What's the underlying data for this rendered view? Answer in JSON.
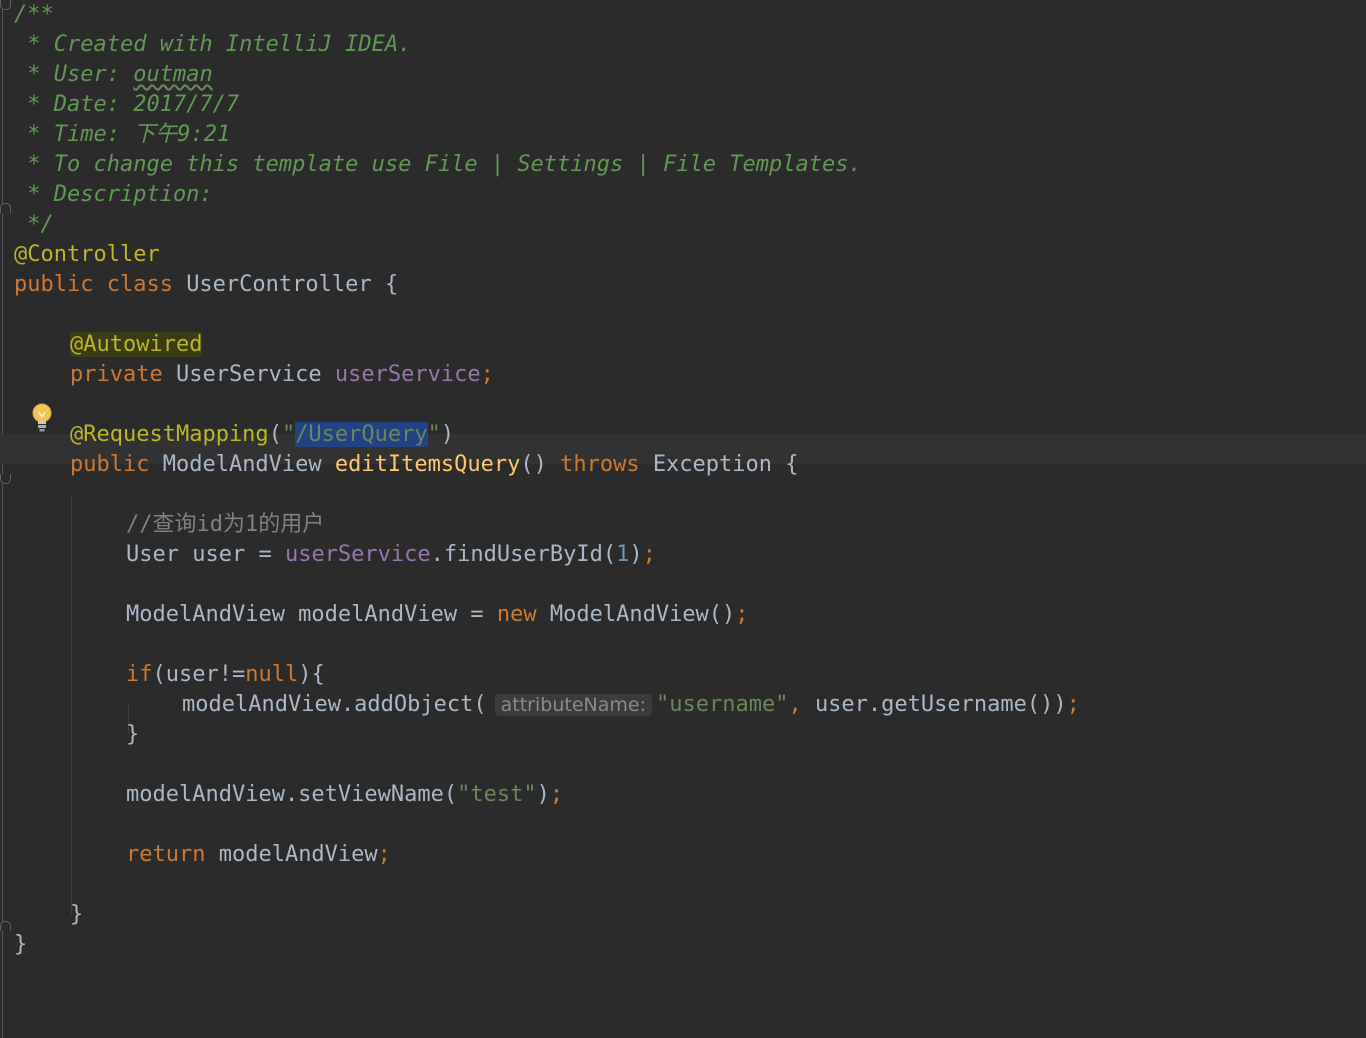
{
  "editor": {
    "code_lines": [
      {
        "row": 0,
        "tokens": [
          {
            "t": "/**",
            "c": "cmt-doc"
          }
        ]
      },
      {
        "row": 1,
        "tokens": [
          {
            "t": " * Created with IntelliJ IDEA.",
            "c": "cmt-doc"
          }
        ]
      },
      {
        "row": 2,
        "tokens": [
          {
            "t": " * User: ",
            "c": "cmt-doc"
          },
          {
            "t": "outman",
            "c": "cmt-doc typo"
          }
        ]
      },
      {
        "row": 3,
        "tokens": [
          {
            "t": " * Date: 2017/7/7",
            "c": "cmt-doc"
          }
        ]
      },
      {
        "row": 4,
        "tokens": [
          {
            "t": " * Time: 下午9:21",
            "c": "cmt-doc"
          }
        ]
      },
      {
        "row": 5,
        "tokens": [
          {
            "t": " * To change this template use File | Settings | File Templates.",
            "c": "cmt-doc"
          }
        ]
      },
      {
        "row": 6,
        "tokens": [
          {
            "t": " * Description:",
            "c": "cmt-doc"
          }
        ]
      },
      {
        "row": 7,
        "tokens": [
          {
            "t": " */",
            "c": "cmt-doc"
          }
        ]
      },
      {
        "row": 8,
        "indent": 0,
        "tokens": [
          {
            "t": "@Controller",
            "c": "ann"
          }
        ]
      },
      {
        "row": 9,
        "indent": 0,
        "tokens": [
          {
            "t": "public class ",
            "c": "kw"
          },
          {
            "t": "UserController {",
            "c": "plain"
          }
        ]
      },
      {
        "row": 11,
        "indent": 1,
        "tokens": [
          {
            "t": "@Autowired",
            "c": "ann autowired-hl"
          }
        ]
      },
      {
        "row": 12,
        "indent": 1,
        "tokens": [
          {
            "t": "private ",
            "c": "kw"
          },
          {
            "t": "UserService ",
            "c": "plain"
          },
          {
            "t": "userService",
            "c": "field"
          },
          {
            "t": ";",
            "c": "punct"
          }
        ]
      },
      {
        "row": 14,
        "indent": 1,
        "tokens": [
          {
            "t": "@RequestMapping",
            "c": "ann"
          },
          {
            "t": "(",
            "c": "plain"
          },
          {
            "t": "\"",
            "c": "str"
          },
          {
            "t": "/UserQuery",
            "c": "str selected"
          },
          {
            "t": "\"",
            "c": "str"
          },
          {
            "t": ")",
            "c": "plain"
          }
        ]
      },
      {
        "row": 15,
        "indent": 1,
        "tokens": [
          {
            "t": "public ",
            "c": "kw"
          },
          {
            "t": "ModelAndView ",
            "c": "plain"
          },
          {
            "t": "editItemsQuery",
            "c": "method"
          },
          {
            "t": "() ",
            "c": "plain"
          },
          {
            "t": "throws ",
            "c": "kw"
          },
          {
            "t": "Exception {",
            "c": "plain"
          }
        ]
      },
      {
        "row": 17,
        "indent": 2,
        "tokens": [
          {
            "t": "//查询id为1的用户",
            "c": "cmt"
          }
        ]
      },
      {
        "row": 18,
        "indent": 2,
        "tokens": [
          {
            "t": "User user = ",
            "c": "plain"
          },
          {
            "t": "userService",
            "c": "field"
          },
          {
            "t": ".findUserById(",
            "c": "plain"
          },
          {
            "t": "1",
            "c": "num"
          },
          {
            "t": ")",
            "c": "plain"
          },
          {
            "t": ";",
            "c": "punct"
          }
        ]
      },
      {
        "row": 20,
        "indent": 2,
        "tokens": [
          {
            "t": "ModelAndView modelAndView = ",
            "c": "plain"
          },
          {
            "t": "new ",
            "c": "kw"
          },
          {
            "t": "ModelAndView()",
            "c": "plain"
          },
          {
            "t": ";",
            "c": "punct"
          }
        ]
      },
      {
        "row": 22,
        "indent": 2,
        "tokens": [
          {
            "t": "if",
            "c": "kw"
          },
          {
            "t": "(user!=",
            "c": "plain"
          },
          {
            "t": "null",
            "c": "kw"
          },
          {
            "t": "){",
            "c": "plain"
          }
        ]
      },
      {
        "row": 23,
        "indent": 3,
        "tokens": [
          {
            "t": "modelAndView.addObject(",
            "c": "plain"
          },
          {
            "t": "attributeName:",
            "c": "hint"
          },
          {
            "t": "\"username\"",
            "c": "str"
          },
          {
            "t": ", ",
            "c": "punct"
          },
          {
            "t": "user.getUsername())",
            "c": "plain"
          },
          {
            "t": ";",
            "c": "punct"
          }
        ]
      },
      {
        "row": 24,
        "indent": 2,
        "tokens": [
          {
            "t": "}",
            "c": "plain"
          }
        ]
      },
      {
        "row": 26,
        "indent": 2,
        "tokens": [
          {
            "t": "modelAndView.setViewName(",
            "c": "plain"
          },
          {
            "t": "\"test\"",
            "c": "str"
          },
          {
            "t": ")",
            "c": "plain"
          },
          {
            "t": ";",
            "c": "punct"
          }
        ]
      },
      {
        "row": 28,
        "indent": 2,
        "tokens": [
          {
            "t": "return ",
            "c": "kw"
          },
          {
            "t": "modelAndView",
            "c": "plain"
          },
          {
            "t": ";",
            "c": "punct"
          }
        ]
      },
      {
        "row": 30,
        "indent": 1,
        "tokens": [
          {
            "t": "}",
            "c": "plain"
          }
        ]
      },
      {
        "row": 31,
        "indent": 0,
        "tokens": [
          {
            "t": "}",
            "c": "plain"
          }
        ]
      }
    ],
    "colors": {
      "background": "#2b2b2b",
      "keyword": "#cc7832",
      "annotation": "#bbb529",
      "string": "#6a8759",
      "doc_comment": "#629755",
      "field": "#9876aa",
      "method": "#ffc66d",
      "number": "#6897bb",
      "selection": "#214283"
    }
  }
}
